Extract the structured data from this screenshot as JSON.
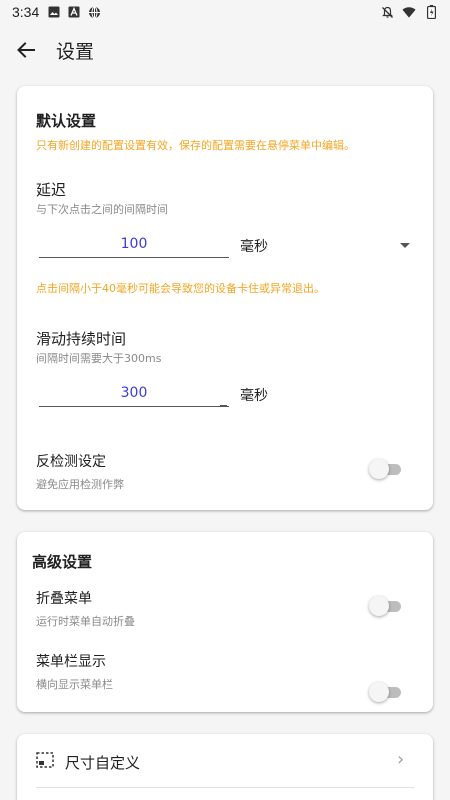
{
  "status_bar": {
    "time": "3:34",
    "left_icons": [
      "image-icon",
      "text-icon",
      "globe-icon"
    ],
    "right_icons": [
      "notifications-off-icon",
      "wifi-icon",
      "battery-icon"
    ]
  },
  "app_bar": {
    "title": "设置",
    "back_icon": "arrow-back-icon"
  },
  "default_settings": {
    "title": "默认设置",
    "note": "只有新创建的配置设置有效，保存的配置需要在悬停菜单中编辑。",
    "delay": {
      "title": "延迟",
      "desc": "与下次点击之间的间隔时间",
      "value": "100",
      "unit": "毫秒",
      "warning": "点击间隔小于40毫秒可能会导致您的设备卡住或异常退出。"
    },
    "swipe_duration": {
      "title": "滑动持续时间",
      "desc": "间隔时间需要大于300ms",
      "value": "300",
      "unit": "毫秒"
    },
    "anti_detection": {
      "title": "反检测设定",
      "desc": "避免应用检测作弊",
      "enabled": false
    }
  },
  "advanced_settings": {
    "title": "高级设置",
    "fold_menu": {
      "title": "折叠菜单",
      "desc": "运行时菜单自动折叠",
      "enabled": false
    },
    "menu_bar_display": {
      "title": "菜单栏显示",
      "desc": "横向显示菜单栏",
      "enabled": false
    }
  },
  "custom_size": {
    "label": "尺寸自定义",
    "icon": "crop-free-icon"
  },
  "colors": {
    "accent_warning": "#f5a623",
    "input_text": "#3c3cd0",
    "switch_off_track": "#bdbdbd"
  }
}
